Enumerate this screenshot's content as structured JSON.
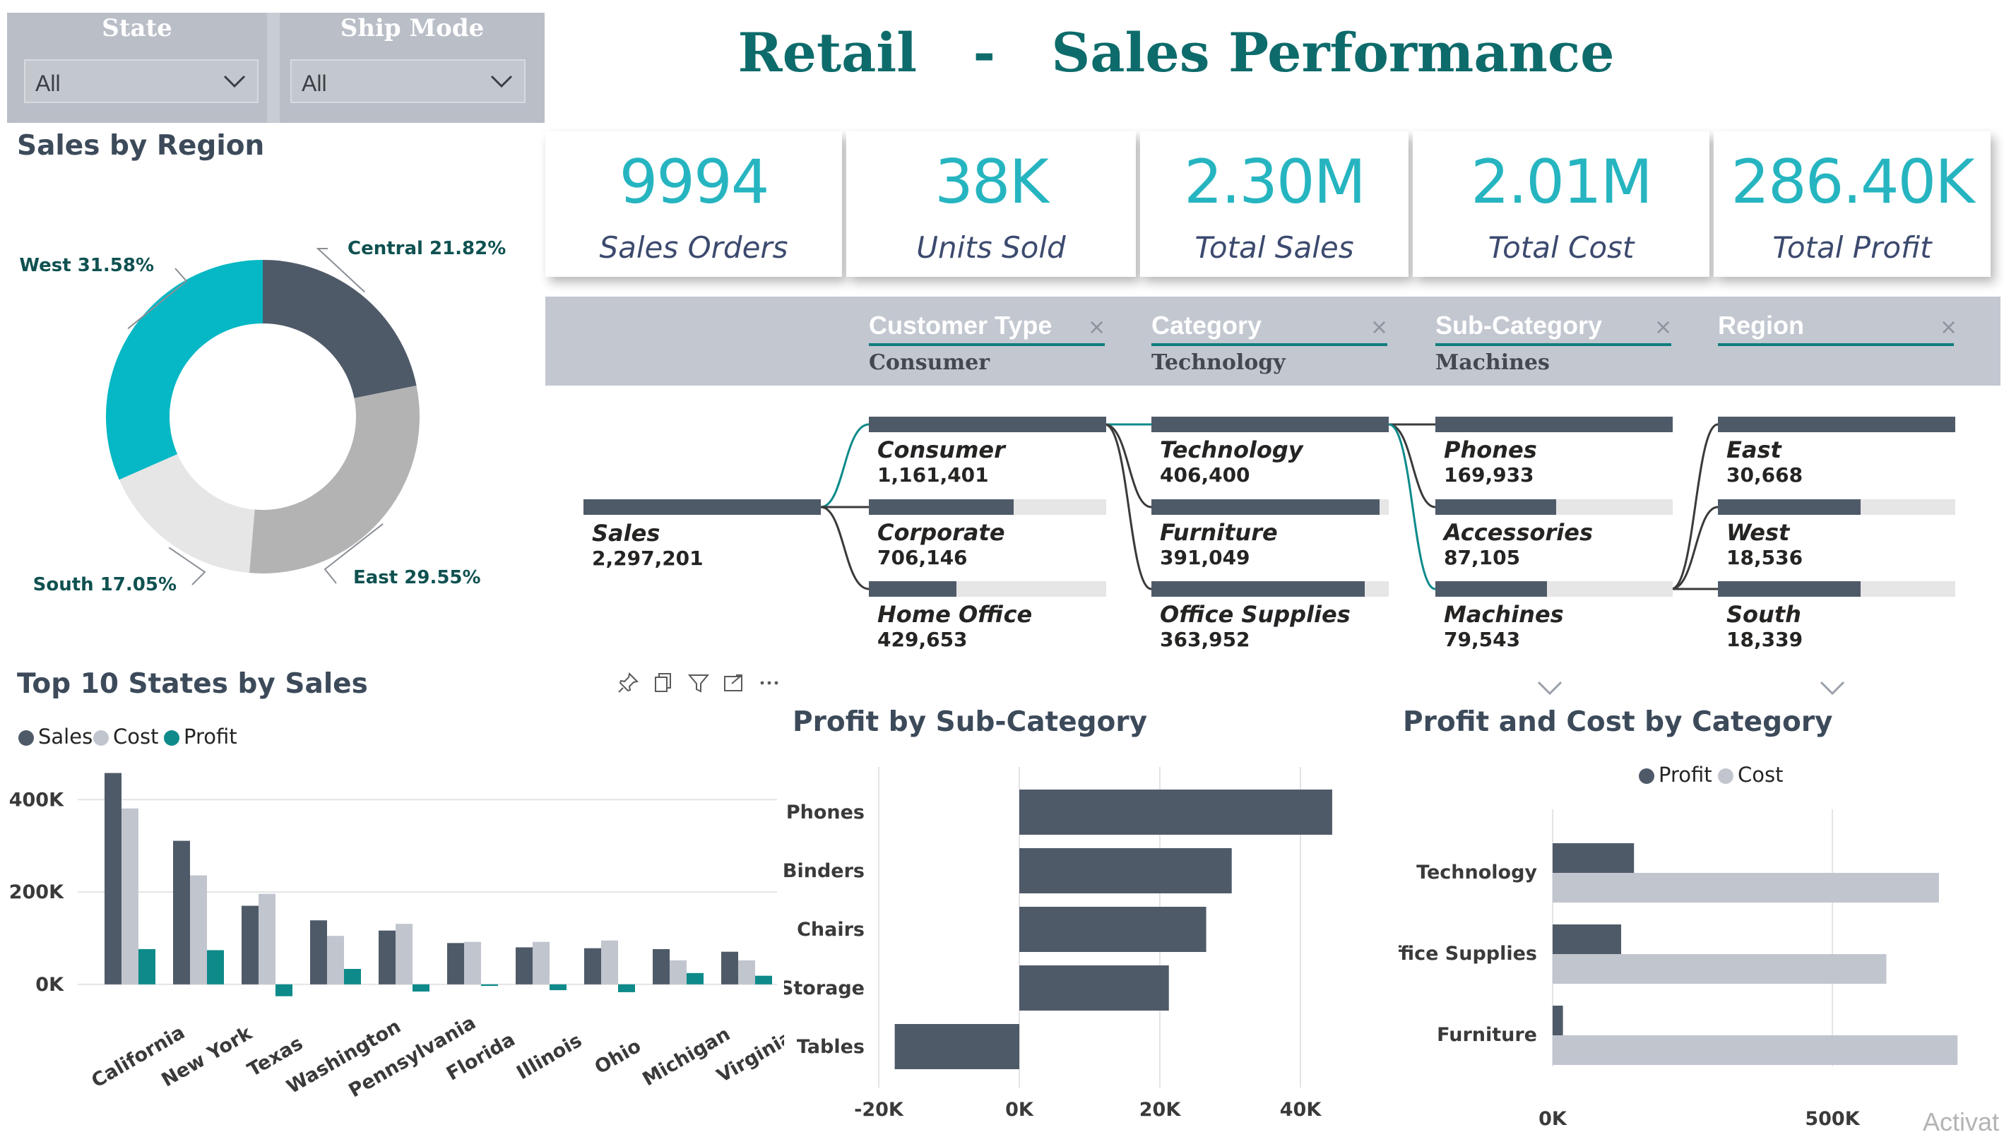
{
  "title": "Retail   -   Sales Performance",
  "slicers": [
    {
      "title": "State",
      "value": "All"
    },
    {
      "title": "Ship Mode",
      "value": "All"
    }
  ],
  "kpis": [
    {
      "value": "9994",
      "label": "Sales Orders"
    },
    {
      "value": "38K",
      "label": "Units Sold"
    },
    {
      "value": "2.30M",
      "label": "Total Sales"
    },
    {
      "value": "2.01M",
      "label": "Total Cost"
    },
    {
      "value": "286.40K",
      "label": "Total Profit"
    }
  ],
  "decomposition": {
    "levels": [
      {
        "label": "Customer Type",
        "selected": "Consumer",
        "close": "×"
      },
      {
        "label": "Category",
        "selected": "Technology",
        "close": "×"
      },
      {
        "label": "Sub-Category",
        "selected": "Machines",
        "close": "×"
      },
      {
        "label": "Region",
        "selected": "",
        "close": "×"
      }
    ],
    "root": {
      "name": "Sales",
      "value": "2,297,201"
    },
    "columns": [
      [
        {
          "name": "Consumer",
          "value": "1,161,401",
          "fraction": 1.0
        },
        {
          "name": "Corporate",
          "value": "706,146",
          "fraction": 0.61
        },
        {
          "name": "Home Office",
          "value": "429,653",
          "fraction": 0.37
        }
      ],
      [
        {
          "name": "Technology",
          "value": "406,400",
          "fraction": 1.0
        },
        {
          "name": "Furniture",
          "value": "391,049",
          "fraction": 0.96
        },
        {
          "name": "Office Supplies",
          "value": "363,952",
          "fraction": 0.9
        }
      ],
      [
        {
          "name": "Phones",
          "value": "169,933",
          "fraction": 1.0
        },
        {
          "name": "Accessories",
          "value": "87,105",
          "fraction": 0.51
        },
        {
          "name": "Machines",
          "value": "79,543",
          "fraction": 0.47
        }
      ],
      [
        {
          "name": "East",
          "value": "30,668",
          "fraction": 1.0
        },
        {
          "name": "West",
          "value": "18,536",
          "fraction": 0.6
        },
        {
          "name": "South",
          "value": "18,339",
          "fraction": 0.6
        }
      ]
    ]
  },
  "visual_toolbar": [
    "pin-icon",
    "copy-icon",
    "filter-icon",
    "focus-mode-icon",
    "more-options-icon"
  ],
  "colors": {
    "sales": "#4f5a69",
    "cost": "#c1c5ce",
    "profit": "#0e8a8a",
    "accent": "#26b5c0",
    "title": "#0e6b6b"
  },
  "watermark": "Activat",
  "chart_data": [
    {
      "type": "pie",
      "title": "Sales by Region",
      "donut": true,
      "slices": [
        {
          "label": "Central 21.82%",
          "name": "Central",
          "value": 21.82,
          "color": "#4f5a69"
        },
        {
          "label": "East 29.55%",
          "name": "East",
          "value": 29.55,
          "color": "#b3b3b3"
        },
        {
          "label": "South 17.05%",
          "name": "South",
          "value": 17.05,
          "color": "#e6e6e6"
        },
        {
          "label": "West 31.58%",
          "name": "West",
          "value": 31.58,
          "color": "#06b8c5"
        }
      ]
    },
    {
      "type": "bar",
      "title": "Top 10 States by Sales",
      "categories": [
        "California",
        "New York",
        "Texas",
        "Washington",
        "Pennsylvania",
        "Florida",
        "Illinois",
        "Ohio",
        "Michigan",
        "Virginia"
      ],
      "series": [
        {
          "name": "Sales",
          "color": "#4f5a69",
          "values": [
            457688,
            310876,
            170188,
            138641,
            116512,
            89474,
            80166,
            78258,
            76270,
            70637
          ]
        },
        {
          "name": "Cost",
          "color": "#c1c5ce",
          "values": [
            381000,
            236000,
            196000,
            105000,
            131000,
            92000,
            92000,
            95000,
            52000,
            52000
          ]
        },
        {
          "name": "Profit",
          "color": "#0e8a8a",
          "values": [
            76381,
            74039,
            -25729,
            33403,
            -15560,
            -3399,
            -12608,
            -16971,
            24463,
            18598
          ]
        }
      ],
      "yticks": [
        "0K",
        "200K",
        "400K"
      ],
      "ytick_values": [
        0,
        200000,
        400000
      ],
      "ylim": [
        -40000,
        480000
      ],
      "legend": "top-left",
      "grid": true
    },
    {
      "type": "bar",
      "orientation": "horizontal",
      "title": "Profit by Sub-Category",
      "categories": [
        "Phones",
        "Binders",
        "Chairs",
        "Storage",
        "Tables"
      ],
      "values": [
        44516,
        30222,
        26590,
        21279,
        -17725
      ],
      "color": "#4f5a69",
      "xticks": [
        "-20K",
        "0K",
        "20K",
        "40K"
      ],
      "xtick_values": [
        -20000,
        0,
        20000,
        40000
      ],
      "xlim": [
        -20000,
        48000
      ],
      "grid": true
    },
    {
      "type": "bar",
      "orientation": "horizontal",
      "title": "Profit and Cost by Category",
      "categories": [
        "Technology",
        "Office Supplies",
        "Furniture"
      ],
      "series": [
        {
          "name": "Profit",
          "color": "#4f5a69",
          "values": [
            145455,
            122491,
            18451
          ]
        },
        {
          "name": "Cost",
          "color": "#c1c5ce",
          "values": [
            690544,
            596569,
            723851
          ]
        }
      ],
      "xticks": [
        "0K",
        "500K"
      ],
      "xtick_values": [
        0,
        500000
      ],
      "xlim": [
        0,
        723851
      ],
      "legend": "top-center",
      "grid": true
    }
  ]
}
